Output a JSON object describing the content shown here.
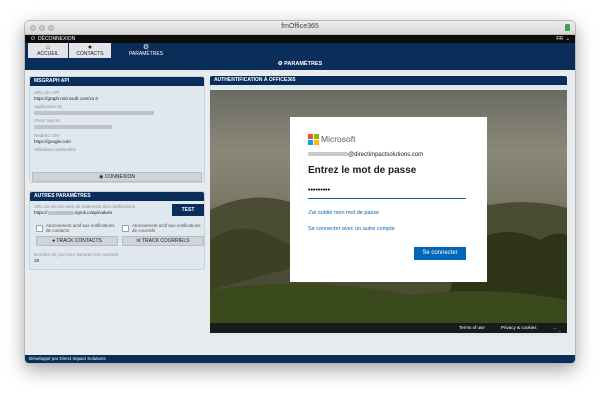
{
  "window": {
    "title": "fmOffice365"
  },
  "topbar": {
    "logout": "DÉCONNEXION",
    "lang": "FR"
  },
  "tabs": [
    {
      "label": "ACCUEIL",
      "icon": "home-icon"
    },
    {
      "label": "CONTACTS",
      "icon": "user-icon"
    },
    {
      "label": "PARAMÈTRES",
      "icon": "gear-icon"
    }
  ],
  "subnav": {
    "label": "PARAMÈTRES"
  },
  "msgraph": {
    "title": "MSGRAPH API",
    "url_label": "URL de l'API",
    "url_value": "https://graph.microsoft.com/v1.0",
    "appid_label": "Application ID",
    "secret_label": "Client Secret",
    "redirect_label": "Redirect URI",
    "redirect_value": "https://google.com",
    "user_label": "Utilisateur authentifié",
    "connect_label": "CONNEXION"
  },
  "autres": {
    "title": "AUTRES PARAMÈTRES",
    "webhook_label": "URL du service web de traitement des notifications",
    "webhook_prefix": "https://",
    "webhook_suffix": ".ngrok.io/api/values",
    "test_label": "TEST",
    "sub_contacts": "Abonnement actif aux notifications de contacts",
    "sub_mail": "Abonnement actif aux notifications de courriels",
    "track_contacts": "TRACK CONTACTS",
    "track_mail": "TRACK COURRIELS",
    "days_label": "Nombre de jour pour importer les courriels",
    "days_value": "28"
  },
  "auth": {
    "title": "AUTHENTIFICATION À OFFICE365",
    "brand": "Microsoft",
    "email_suffix": "@directimpactsolutions.com",
    "heading": "Entrez le mot de passe",
    "password_mask": "•••••••••",
    "forgot": "J'ai oublié mon mot de passe",
    "other": "Se connecter avec un autre compte",
    "signin": "Se connecter",
    "terms": "Terms of use",
    "privacy": "Privacy & cookies",
    "more": "..."
  },
  "footer": {
    "text": "Développé par Direct Impact Solutions"
  },
  "colors": {
    "navy": "#0b2d5a",
    "ms_blue": "#0067b8"
  }
}
